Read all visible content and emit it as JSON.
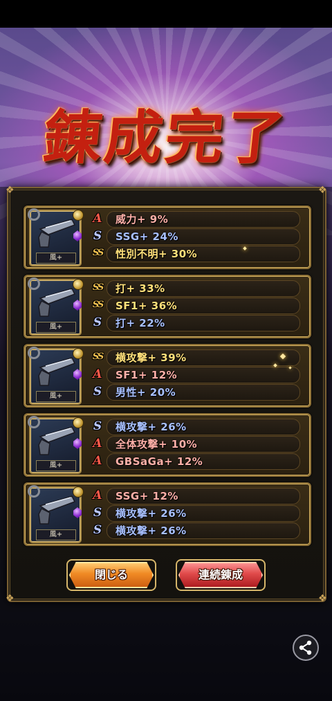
{
  "title": "錬成完了",
  "cards": [
    {
      "weapon_tag": "風+",
      "lines": [
        {
          "rank": "A",
          "text": "威力+ 9%"
        },
        {
          "rank": "S",
          "text": "SSG+ 24%"
        },
        {
          "rank": "SS",
          "text": "性別不明+ 30%"
        }
      ]
    },
    {
      "weapon_tag": "風+",
      "lines": [
        {
          "rank": "SS",
          "text": "打+ 33%"
        },
        {
          "rank": "SS",
          "text": "SF1+ 36%"
        },
        {
          "rank": "S",
          "text": "打+ 22%"
        }
      ]
    },
    {
      "weapon_tag": "風+",
      "lines": [
        {
          "rank": "SS",
          "text": "横攻撃+ 39%"
        },
        {
          "rank": "A",
          "text": "SF1+ 12%"
        },
        {
          "rank": "S",
          "text": "男性+ 20%"
        }
      ]
    },
    {
      "weapon_tag": "風+",
      "lines": [
        {
          "rank": "S",
          "text": "横攻撃+ 26%"
        },
        {
          "rank": "A",
          "text": "全体攻撃+ 10%"
        },
        {
          "rank": "A",
          "text": "GBSaGa+ 12%"
        }
      ]
    },
    {
      "weapon_tag": "風+",
      "lines": [
        {
          "rank": "A",
          "text": "SSG+ 12%"
        },
        {
          "rank": "S",
          "text": "横攻撃+ 26%"
        },
        {
          "rank": "S",
          "text": "横攻撃+ 26%"
        }
      ]
    }
  ],
  "buttons": {
    "close": "閉じる",
    "continue": "連続錬成"
  },
  "icons": {
    "weapon": "handgun-icon",
    "share": "share-icon"
  },
  "colors": {
    "title": "#c42010",
    "panel_border": "#8d7036",
    "close_button": "#f08a24",
    "continue_button": "#e04a4a"
  }
}
